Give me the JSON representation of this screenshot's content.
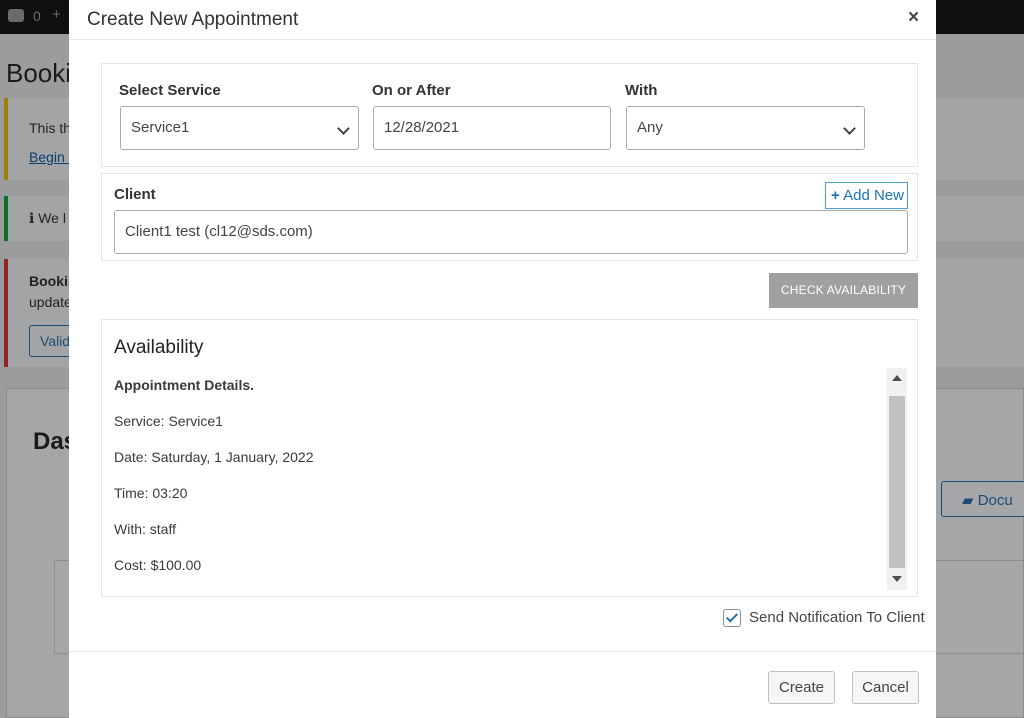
{
  "background": {
    "adminbar_comment_count": "0",
    "page_title": "Booki",
    "notice_yellow": {
      "text": "This th",
      "link": "Begin i"
    },
    "notice_green": {
      "text": "We l"
    },
    "notice_red": {
      "text1": "Bookin",
      "text2": "update",
      "button": "Valid"
    },
    "dashboard_heading": "Das",
    "doc_button": "Docu"
  },
  "modal": {
    "title": "Create New Appointment",
    "close_glyph": "×",
    "service": {
      "label": "Select Service",
      "value": "Service1"
    },
    "date": {
      "label": "On or After",
      "value": "12/28/2021"
    },
    "with": {
      "label": "With",
      "value": "Any"
    },
    "client": {
      "label": "Client",
      "add_new": "Add New",
      "add_new_glyph": "+",
      "value": "Client1 test (cl12@sds.com)"
    },
    "check_availability": "CHECK AVAILABILITY",
    "availability": {
      "title": "Availability",
      "heading": "Appointment Details.",
      "service": "Service: Service1",
      "date": "Date: Saturday, 1 January, 2022",
      "time": "Time: 03:20",
      "with": "With: staff",
      "cost": "Cost: $100.00"
    },
    "notify": {
      "label": "Send Notification To Client",
      "checked": true
    },
    "buttons": {
      "create": "Create",
      "cancel": "Cancel"
    }
  },
  "colors": {
    "overlay": "#9b9c9d",
    "check_button": "#a0a0a0",
    "link_blue": "#1a73b7",
    "checkbox_blue": "#2271b1"
  }
}
